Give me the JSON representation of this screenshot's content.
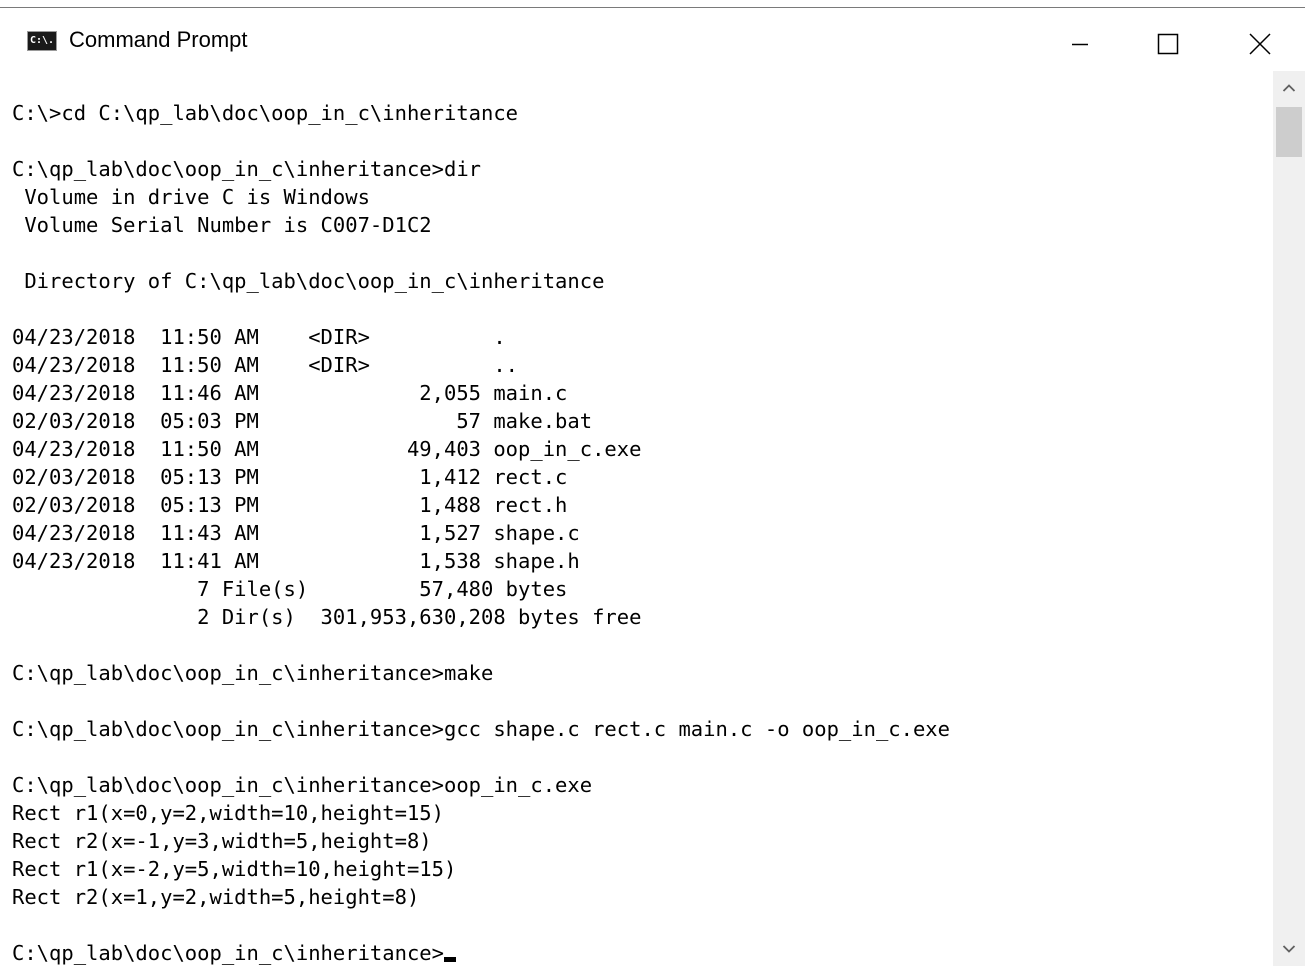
{
  "window": {
    "title": "Command Prompt",
    "icon": "cmd-icon",
    "icon_label": "C:\\.",
    "controls": [
      "minimize-icon",
      "maximize-icon",
      "close-icon"
    ]
  },
  "console": {
    "lines": [
      "C:\\>cd C:\\qp_lab\\doc\\oop_in_c\\inheritance",
      "",
      "C:\\qp_lab\\doc\\oop_in_c\\inheritance>dir",
      " Volume in drive C is Windows",
      " Volume Serial Number is C007-D1C2",
      "",
      " Directory of C:\\qp_lab\\doc\\oop_in_c\\inheritance",
      "",
      "04/23/2018  11:50 AM    <DIR>          .",
      "04/23/2018  11:50 AM    <DIR>          ..",
      "04/23/2018  11:46 AM             2,055 main.c",
      "02/03/2018  05:03 PM                57 make.bat",
      "04/23/2018  11:50 AM            49,403 oop_in_c.exe",
      "02/03/2018  05:13 PM             1,412 rect.c",
      "02/03/2018  05:13 PM             1,488 rect.h",
      "04/23/2018  11:43 AM             1,527 shape.c",
      "04/23/2018  11:41 AM             1,538 shape.h",
      "               7 File(s)         57,480 bytes",
      "               2 Dir(s)  301,953,630,208 bytes free",
      "",
      "C:\\qp_lab\\doc\\oop_in_c\\inheritance>make",
      "",
      "C:\\qp_lab\\doc\\oop_in_c\\inheritance>gcc shape.c rect.c main.c -o oop_in_c.exe",
      "",
      "C:\\qp_lab\\doc\\oop_in_c\\inheritance>oop_in_c.exe",
      "Rect r1(x=0,y=2,width=10,height=15)",
      "Rect r2(x=-1,y=3,width=5,height=8)",
      "Rect r1(x=-2,y=5,width=10,height=15)",
      "Rect r2(x=1,y=2,width=5,height=8)",
      "",
      "C:\\qp_lab\\doc\\oop_in_c\\inheritance>"
    ]
  },
  "scrollbar": {
    "up_icon": "chevron-up-icon",
    "down_icon": "chevron-down-icon"
  },
  "colors": {
    "background": "#ffffff",
    "text": "#000000",
    "scrollbar_track": "#f0f0f0",
    "scrollbar_thumb": "#cdcdcd"
  }
}
